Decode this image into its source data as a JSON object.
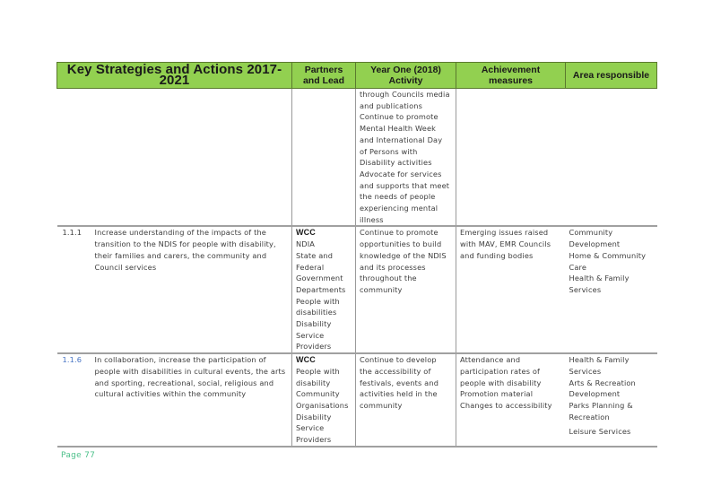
{
  "table": {
    "headers": {
      "strategy": "Key Strategies and Actions 2017-2021",
      "partners": "Partners and Lead",
      "activity": "Year One (2018) Activity",
      "measures": "Achievement measures",
      "area": "Area responsible"
    },
    "continuation": {
      "activity_lines": [
        "through Councils media",
        "and publications",
        "Continue to promote",
        "Mental Health Week",
        "and International Day",
        "of Persons with",
        "Disability activities",
        "Advocate for services",
        "and supports that meet",
        "the needs of people",
        "experiencing mental",
        "illness"
      ]
    },
    "rows": [
      {
        "number": "1.1.1",
        "strategy_lines": [
          "Increase understanding of the impacts of the",
          "transition to the NDIS for people with disability,",
          "their families and carers, the community and",
          "Council services"
        ],
        "lead": "WCC",
        "partners_lines": [
          "NDIA",
          "State and",
          "Federal",
          "Government",
          "Departments",
          "People with",
          "disabilities",
          "Disability",
          "Service",
          "Providers"
        ],
        "activity_lines": [
          "Continue to promote",
          "opportunities to build",
          "knowledge of the NDIS",
          "and its processes",
          "throughout the",
          "community"
        ],
        "measures_lines": [
          "Emerging issues raised",
          "with MAV, EMR Councils",
          "and funding bodies"
        ],
        "area_lines": [
          "Community",
          "Development",
          "Home & Community",
          "Care",
          "Health & Family",
          "Services"
        ]
      },
      {
        "number": "1.1.6",
        "strategy_lines": [
          "In collaboration, increase the participation of",
          "people with disabilities in cultural events, the arts",
          "and  sporting, recreational, social, religious and",
          "cultural activities within the community"
        ],
        "lead": "WCC",
        "partners_lines": [
          "People with",
          "disability",
          "Community",
          "Organisations",
          "Disability",
          "Service",
          "Providers"
        ],
        "activity_lines": [
          "Continue to develop",
          "the accessibility of",
          "festivals, events and",
          "activities held in the",
          "community"
        ],
        "measures_lines": [
          "Attendance and",
          "participation rates of",
          "people with disability",
          "Promotion material",
          "Changes to accessibility"
        ],
        "area_lines": [
          "Health & Family",
          "Services",
          "Arts & Recreation",
          "Development",
          "Parks Planning &",
          "Recreation"
        ],
        "area_extra": "Leisure Services"
      }
    ]
  },
  "footer": {
    "page_label": "Page 77"
  },
  "colors": {
    "header_bg": "#92d050",
    "footer_text": "#4cc08a",
    "link_number": "#4472c4"
  }
}
